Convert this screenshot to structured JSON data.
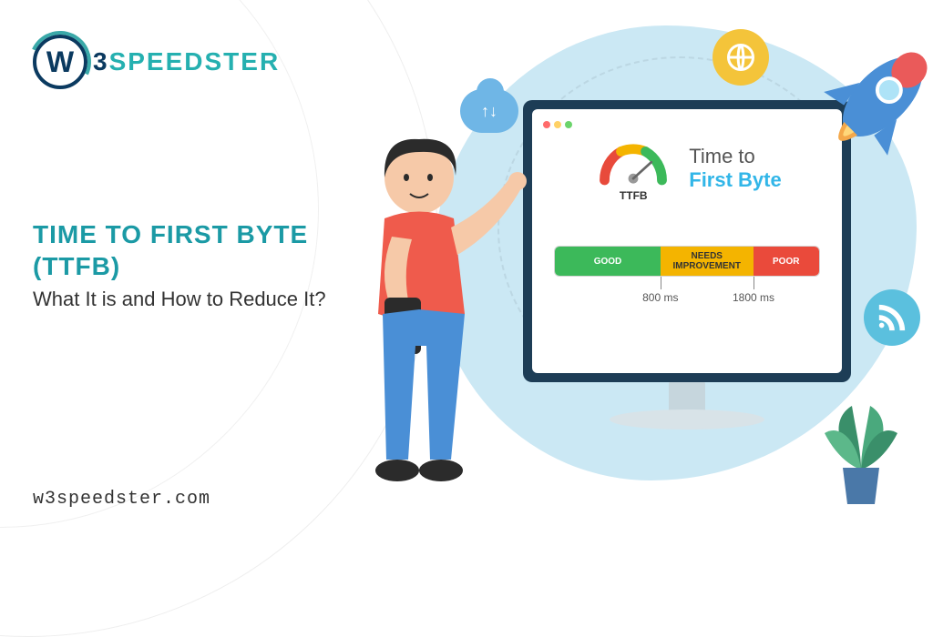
{
  "logo": {
    "num": "3",
    "word": "SPEEDSTER"
  },
  "headline": {
    "line1": "TIME TO FIRST BYTE",
    "line2": "(TTFB)",
    "sub": "What It is and How to Reduce It?"
  },
  "footer": {
    "url": "w3speedster.com"
  },
  "screen": {
    "gauge_label": "TTFB",
    "title_line1": "Time to",
    "title_line2": "First Byte",
    "segments": {
      "good": "GOOD",
      "mid": "NEEDS\nIMPROVEMENT",
      "poor": "POOR"
    },
    "ticks": {
      "t1": "800 ms",
      "t2": "1800 ms"
    }
  },
  "icons": {
    "cloud": "↑↓",
    "globe": "globe-icon",
    "wifi": "rss-icon",
    "rocket": "rocket-icon",
    "plant": "plant-icon"
  }
}
